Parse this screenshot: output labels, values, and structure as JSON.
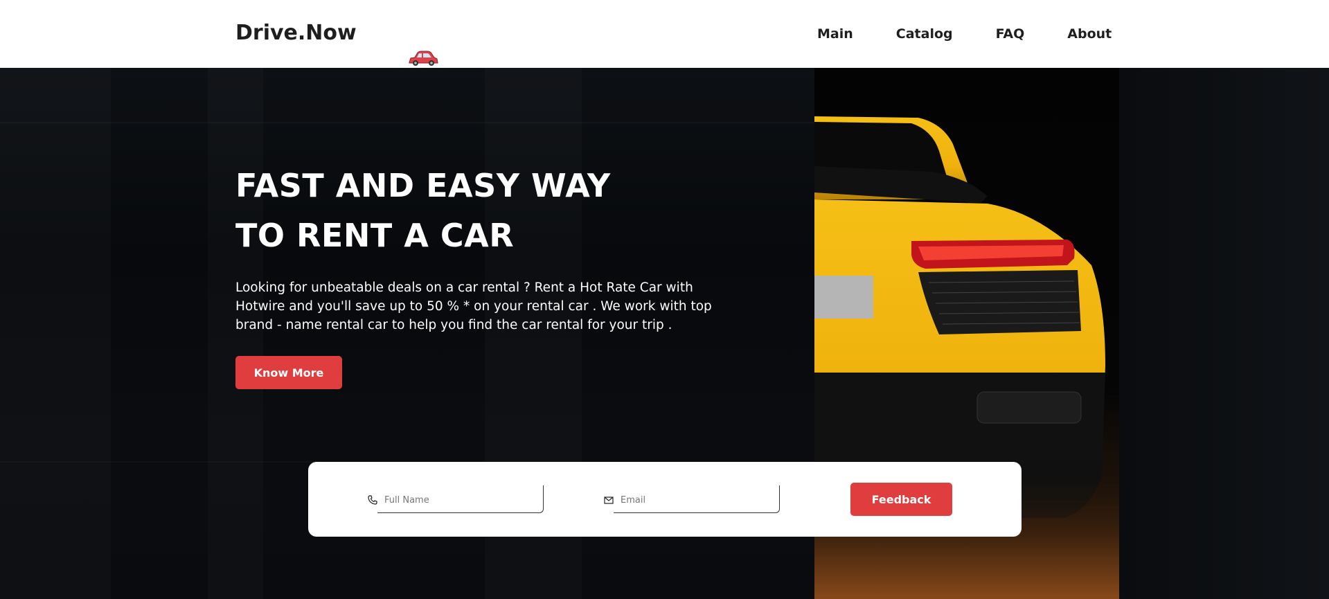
{
  "header": {
    "logo": "Drive.Now",
    "nav": [
      "Main",
      "Catalog",
      "FAQ",
      "About"
    ]
  },
  "hero": {
    "title_line1": "FAST AND EASY WAY",
    "title_line2": "TO RENT A CAR",
    "description": "Looking for unbeatable deals on a car rental ? Rent a Hot Rate Car with Hotwire and you'll save up to 50 % * on your rental car . We work with top brand - name rental car to help you find the car rental for your trip .",
    "cta_label": "Know More"
  },
  "form": {
    "name_placeholder": "Full Name",
    "email_placeholder": "Email",
    "submit_label": "Feedback"
  },
  "icons": {
    "logo_car": "car-icon",
    "name_field": "phone-icon",
    "email_field": "mail-icon"
  },
  "colors": {
    "accent": "#e03e3e",
    "car_yellow": "#f2b70f",
    "header_bg": "#ffffff"
  }
}
